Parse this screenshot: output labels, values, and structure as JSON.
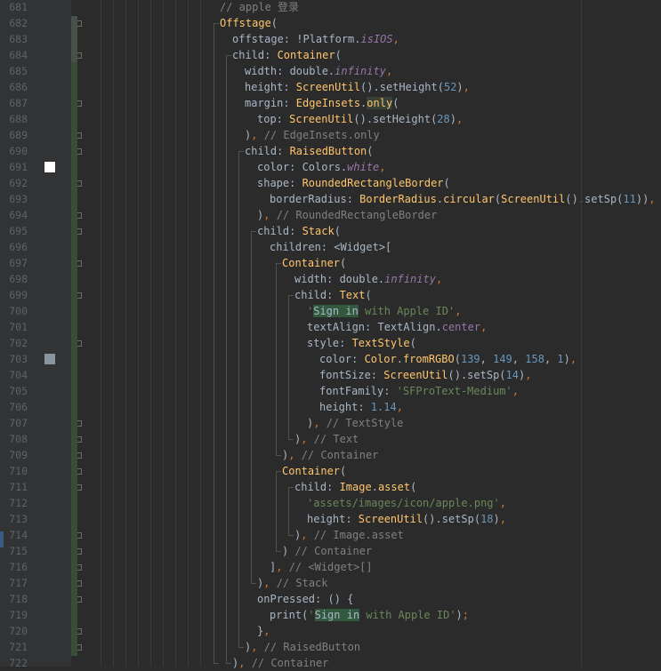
{
  "editor": {
    "lines": [
      {
        "n": "681",
        "indent": 0,
        "segs": [
          [
            "cmt",
            "// apple 登录"
          ]
        ]
      },
      {
        "n": "682",
        "indent": 0,
        "segs": [
          [
            "cls",
            "Offstage"
          ],
          [
            "p",
            "("
          ]
        ]
      },
      {
        "n": "683",
        "indent": 1,
        "segs": [
          [
            "p",
            "offstage: !Platform."
          ],
          [
            "purple",
            "isIOS"
          ],
          [
            "orange",
            ","
          ]
        ]
      },
      {
        "n": "684",
        "indent": 1,
        "segs": [
          [
            "p",
            "child: "
          ],
          [
            "cls",
            "Container"
          ],
          [
            "p",
            "("
          ]
        ]
      },
      {
        "n": "685",
        "indent": 2,
        "segs": [
          [
            "p",
            "width: double."
          ],
          [
            "purple",
            "infinity"
          ],
          [
            "orange",
            ","
          ]
        ]
      },
      {
        "n": "686",
        "indent": 2,
        "segs": [
          [
            "p",
            "height: "
          ],
          [
            "cls",
            "ScreenUtil"
          ],
          [
            "p",
            "().setHeight("
          ],
          [
            "num",
            "52"
          ],
          [
            "p",
            ")"
          ],
          [
            "orange",
            ","
          ]
        ]
      },
      {
        "n": "687",
        "indent": 2,
        "segs": [
          [
            "p",
            "margin: "
          ],
          [
            "cls",
            "EdgeInsets"
          ],
          [
            "p",
            "."
          ],
          [
            "clshl",
            "only"
          ],
          [
            "p",
            "("
          ]
        ]
      },
      {
        "n": "688",
        "indent": 3,
        "segs": [
          [
            "p",
            "top: "
          ],
          [
            "cls",
            "ScreenUtil"
          ],
          [
            "p",
            "().setHeight("
          ],
          [
            "num",
            "28"
          ],
          [
            "p",
            ")"
          ],
          [
            "orange",
            ","
          ]
        ]
      },
      {
        "n": "689",
        "indent": 2,
        "segs": [
          [
            "p",
            ")"
          ],
          [
            "orange",
            ","
          ],
          [
            "cmt",
            " // EdgeInsets.only"
          ]
        ]
      },
      {
        "n": "690",
        "indent": 2,
        "segs": [
          [
            "p",
            "child: "
          ],
          [
            "cls",
            "RaisedButton"
          ],
          [
            "p",
            "("
          ]
        ]
      },
      {
        "n": "691",
        "indent": 3,
        "segs": [
          [
            "p",
            "color: Colors."
          ],
          [
            "purple",
            "white"
          ],
          [
            "orange",
            ","
          ]
        ]
      },
      {
        "n": "692",
        "indent": 3,
        "segs": [
          [
            "p",
            "shape: "
          ],
          [
            "cls",
            "RoundedRectangleBorder"
          ],
          [
            "p",
            "("
          ]
        ]
      },
      {
        "n": "693",
        "indent": 4,
        "segs": [
          [
            "p",
            "borderRadius: "
          ],
          [
            "cls",
            "BorderRadius"
          ],
          [
            "p",
            "."
          ],
          [
            "cls",
            "circular"
          ],
          [
            "p",
            "("
          ],
          [
            "cls",
            "ScreenUtil"
          ],
          [
            "p",
            "().setSp("
          ],
          [
            "num",
            "11"
          ],
          [
            "p",
            "))"
          ],
          [
            "orange",
            ","
          ]
        ]
      },
      {
        "n": "694",
        "indent": 3,
        "segs": [
          [
            "p",
            ")"
          ],
          [
            "orange",
            ","
          ],
          [
            "cmt",
            " // RoundedRectangleBorder"
          ]
        ]
      },
      {
        "n": "695",
        "indent": 3,
        "segs": [
          [
            "p",
            "child: "
          ],
          [
            "cls",
            "Stack"
          ],
          [
            "p",
            "("
          ]
        ]
      },
      {
        "n": "696",
        "indent": 4,
        "segs": [
          [
            "p",
            "children: <Widget>["
          ]
        ]
      },
      {
        "n": "697",
        "indent": 5,
        "segs": [
          [
            "cls",
            "Container"
          ],
          [
            "p",
            "("
          ]
        ]
      },
      {
        "n": "698",
        "indent": 6,
        "segs": [
          [
            "p",
            "width: double."
          ],
          [
            "purple",
            "infinity"
          ],
          [
            "orange",
            ","
          ]
        ]
      },
      {
        "n": "699",
        "indent": 6,
        "segs": [
          [
            "p",
            "child: "
          ],
          [
            "cls",
            "Text"
          ],
          [
            "p",
            "("
          ]
        ]
      },
      {
        "n": "700",
        "indent": 7,
        "segs": [
          [
            "str",
            "'"
          ],
          [
            "hl",
            "Sign in"
          ],
          [
            "str",
            " with Apple ID'"
          ],
          [
            "orange",
            ","
          ]
        ]
      },
      {
        "n": "701",
        "indent": 7,
        "segs": [
          [
            "p",
            "textAlign: TextAlign."
          ],
          [
            "purple2",
            "center"
          ],
          [
            "orange",
            ","
          ]
        ]
      },
      {
        "n": "702",
        "indent": 7,
        "segs": [
          [
            "p",
            "style: "
          ],
          [
            "cls",
            "TextStyle"
          ],
          [
            "p",
            "("
          ]
        ]
      },
      {
        "n": "703",
        "indent": 8,
        "segs": [
          [
            "p",
            "color: "
          ],
          [
            "cls",
            "Color"
          ],
          [
            "p",
            "."
          ],
          [
            "cls",
            "fromRGBO"
          ],
          [
            "p",
            "("
          ],
          [
            "num",
            "139"
          ],
          [
            "p",
            ", "
          ],
          [
            "num",
            "149"
          ],
          [
            "p",
            ", "
          ],
          [
            "num",
            "158"
          ],
          [
            "p",
            ", "
          ],
          [
            "num",
            "1"
          ],
          [
            "p",
            ")"
          ],
          [
            "orange",
            ","
          ]
        ]
      },
      {
        "n": "704",
        "indent": 8,
        "segs": [
          [
            "p",
            "fontSize: "
          ],
          [
            "cls",
            "ScreenUtil"
          ],
          [
            "p",
            "().setSp("
          ],
          [
            "num",
            "14"
          ],
          [
            "p",
            ")"
          ],
          [
            "orange",
            ","
          ]
        ]
      },
      {
        "n": "705",
        "indent": 8,
        "segs": [
          [
            "p",
            "fontFamily: "
          ],
          [
            "str",
            "'SFProText-Medium'"
          ],
          [
            "orange",
            ","
          ]
        ]
      },
      {
        "n": "706",
        "indent": 8,
        "segs": [
          [
            "p",
            "height: "
          ],
          [
            "num",
            "1.14"
          ],
          [
            "orange",
            ","
          ]
        ]
      },
      {
        "n": "707",
        "indent": 7,
        "segs": [
          [
            "p",
            ")"
          ],
          [
            "orange",
            ","
          ],
          [
            "cmt",
            " // TextStyle"
          ]
        ]
      },
      {
        "n": "708",
        "indent": 6,
        "segs": [
          [
            "p",
            ")"
          ],
          [
            "orange",
            ","
          ],
          [
            "cmt",
            " // Text"
          ]
        ]
      },
      {
        "n": "709",
        "indent": 5,
        "segs": [
          [
            "p",
            ")"
          ],
          [
            "orange",
            ","
          ],
          [
            "cmt",
            " // Container"
          ]
        ]
      },
      {
        "n": "710",
        "indent": 5,
        "segs": [
          [
            "cls",
            "Container"
          ],
          [
            "p",
            "("
          ]
        ]
      },
      {
        "n": "711",
        "indent": 6,
        "segs": [
          [
            "p",
            "child: "
          ],
          [
            "cls",
            "Image"
          ],
          [
            "p",
            "."
          ],
          [
            "cls",
            "asset"
          ],
          [
            "p",
            "("
          ]
        ]
      },
      {
        "n": "712",
        "indent": 7,
        "segs": [
          [
            "str",
            "'assets/images/icon/apple.png'"
          ],
          [
            "orange",
            ","
          ]
        ]
      },
      {
        "n": "713",
        "indent": 7,
        "segs": [
          [
            "p",
            "height: "
          ],
          [
            "cls",
            "ScreenUtil"
          ],
          [
            "p",
            "().setSp("
          ],
          [
            "num",
            "18"
          ],
          [
            "p",
            ")"
          ],
          [
            "orange",
            ","
          ]
        ]
      },
      {
        "n": "714",
        "indent": 6,
        "segs": [
          [
            "p",
            ")"
          ],
          [
            "orange",
            ","
          ],
          [
            "cmt",
            " // Image.asset"
          ]
        ]
      },
      {
        "n": "715",
        "indent": 5,
        "segs": [
          [
            "p",
            ")"
          ],
          [
            "cmt",
            " // Container"
          ]
        ]
      },
      {
        "n": "716",
        "indent": 4,
        "segs": [
          [
            "p",
            "]"
          ],
          [
            "orange",
            ","
          ],
          [
            "cmt",
            " // <Widget>[]"
          ]
        ]
      },
      {
        "n": "717",
        "indent": 3,
        "segs": [
          [
            "p",
            ")"
          ],
          [
            "orange",
            ","
          ],
          [
            "cmt",
            " // Stack"
          ]
        ]
      },
      {
        "n": "718",
        "indent": 3,
        "segs": [
          [
            "p",
            "onPressed: () {"
          ]
        ]
      },
      {
        "n": "719",
        "indent": 4,
        "segs": [
          [
            "p",
            "print("
          ],
          [
            "str",
            "'"
          ],
          [
            "hl",
            "Sign in"
          ],
          [
            "str",
            " with Apple ID'"
          ],
          [
            "p",
            ")"
          ],
          [
            "orange",
            ";"
          ]
        ]
      },
      {
        "n": "720",
        "indent": 3,
        "segs": [
          [
            "p",
            "}"
          ],
          [
            "orange",
            ","
          ]
        ]
      },
      {
        "n": "721",
        "indent": 2,
        "segs": [
          [
            "p",
            ")"
          ],
          [
            "orange",
            ","
          ],
          [
            "cmt",
            " // RaisedButton"
          ]
        ]
      },
      {
        "n": "722",
        "indent": 1,
        "segs": [
          [
            "p",
            ")"
          ],
          [
            "orange",
            ","
          ],
          [
            "cmt",
            " // Container"
          ]
        ]
      }
    ]
  },
  "colors": {
    "background": "#2b2b2b",
    "gutter": "#313335",
    "line_number": "#606366",
    "default_text": "#a9b7c6",
    "class_name": "#ffc66d",
    "keyword_purple": "#9876aa",
    "string": "#6a8759",
    "number": "#6897bb",
    "comment": "#808080",
    "punctuation_orange": "#cc7832",
    "search_highlight": "#32593d"
  },
  "gutter_markers": {
    "white_color_swatch_line": "691",
    "grey_color_swatch_line": "703"
  }
}
